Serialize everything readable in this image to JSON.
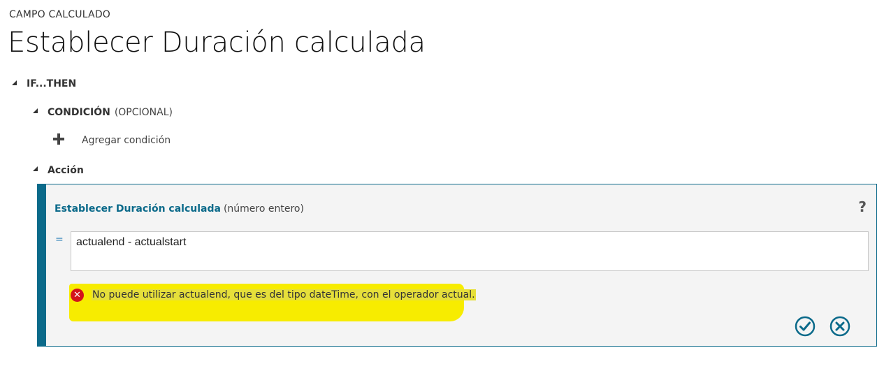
{
  "header": {
    "eyebrow": "CAMPO CALCULADO",
    "title": "Establecer Duración calculada"
  },
  "tree": {
    "if_then": "IF...THEN",
    "condition": {
      "label": "CONDICIÓN",
      "optional": "(OPCIONAL)"
    },
    "add_condition": "Agregar condición",
    "action": "Acción"
  },
  "action_panel": {
    "field": "Establecer Duración calculada",
    "type": "(número entero)",
    "help": "?",
    "equals": "=",
    "expression": "actualend - actualstart",
    "error": "No puede utilizar actualend, que es del tipo dateTime, con el operador actual.",
    "error_icon": "error-x-icon",
    "error_icon_glyph": "✕",
    "accent_color": "#0b6a8a",
    "error_color": "#d4141b",
    "highlight_color": "#f7ec00"
  }
}
